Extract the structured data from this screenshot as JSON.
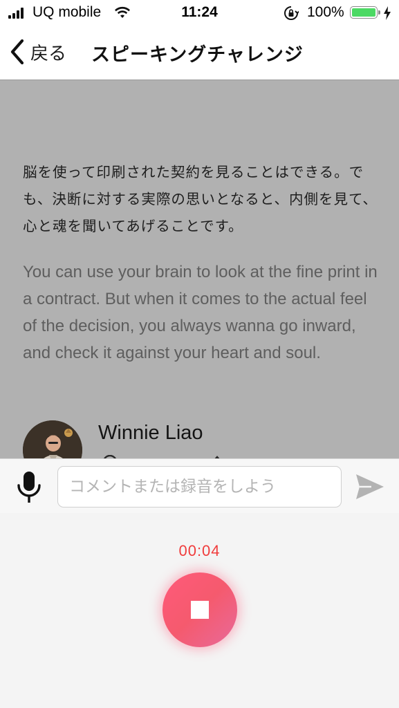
{
  "status_bar": {
    "carrier": "UQ mobile",
    "time": "11:24",
    "battery_percent": "100%",
    "battery_level": 1.0,
    "battery_color": "#4cd964"
  },
  "nav": {
    "back_label": "戻る",
    "title": "スピーキングチャレンジ"
  },
  "quote": {
    "japanese": "脳を使って印刷された契約を見ることはできる。でも、決断に対する実際の思いとなると、内側を見て、心と魂を聞いてあげることです。",
    "english": "You can use your brain to look at the fine print in a contract. But when it comes to the actual feel of the decision, you always wanna go inward, and check it against your heart and soul.",
    "author": "Winnie Liao"
  },
  "input_bar": {
    "placeholder": "コメントまたは録音をしよう",
    "value": ""
  },
  "recording": {
    "elapsed": "00:04",
    "timer_color": "#f03c3c",
    "button_color": "#f55a6e"
  },
  "icons": {
    "back": "chevron-left-icon",
    "mic": "microphone-icon",
    "send": "paper-plane-icon",
    "stop": "stop-icon"
  }
}
